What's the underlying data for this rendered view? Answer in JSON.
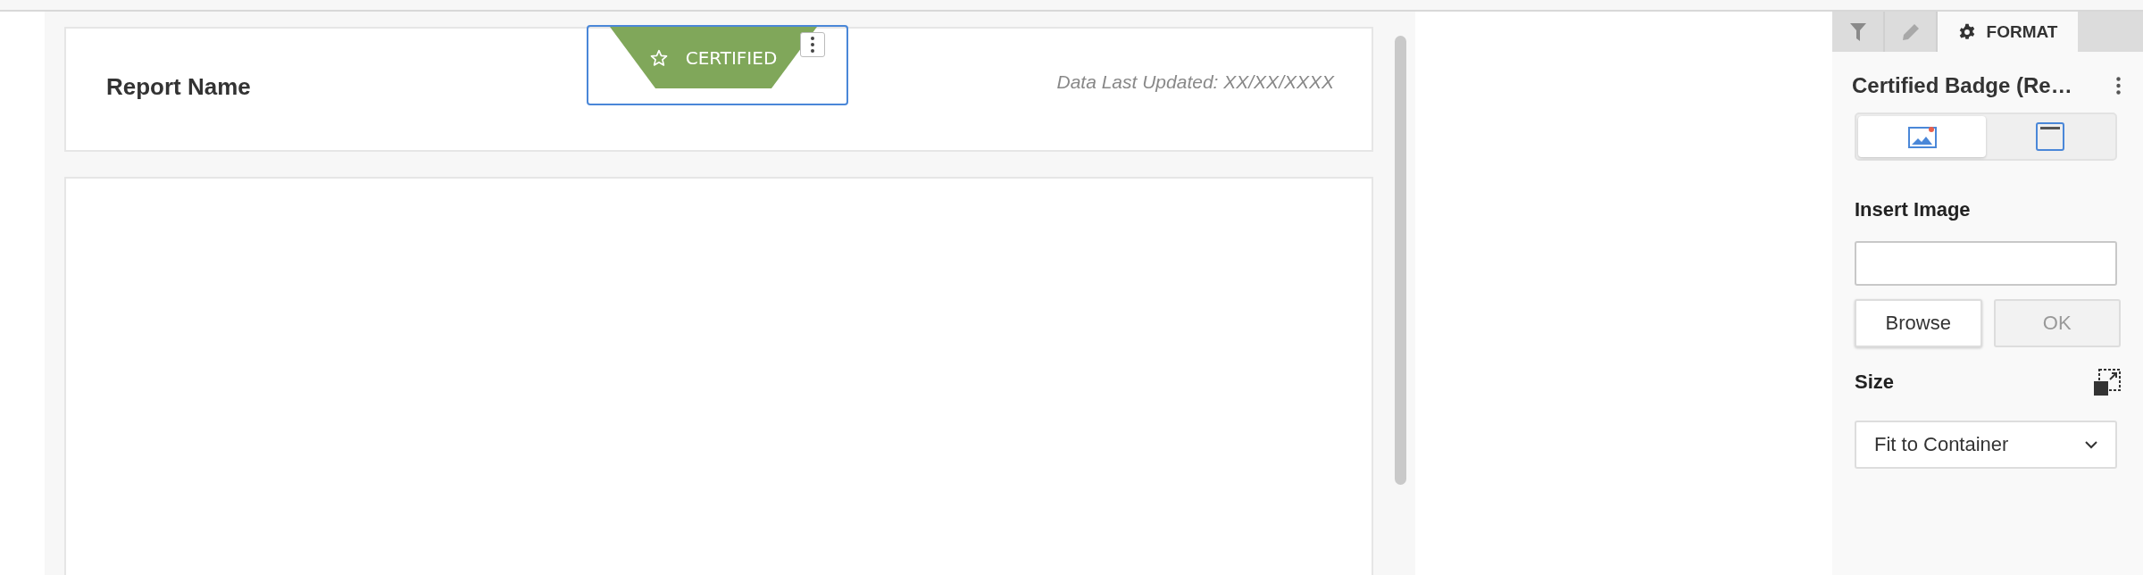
{
  "report": {
    "title": "Report Name",
    "updated": "Data Last Updated: XX/XX/XXXX",
    "badge": {
      "label": "CERTIFIED",
      "selected": true
    }
  },
  "panel": {
    "tabs": [
      {
        "kind": "filter",
        "selected": false
      },
      {
        "kind": "edit",
        "selected": false
      },
      {
        "kind": "format",
        "label": "FORMAT",
        "selected": true
      }
    ],
    "title": "Certified Badge (Re…",
    "modes": [
      {
        "kind": "image",
        "selected": true
      },
      {
        "kind": "banner",
        "selected": false
      }
    ],
    "insert_label": "Insert Image",
    "buttons": [
      {
        "label": "Browse",
        "disabled": false
      },
      {
        "label": "OK",
        "disabled": true
      }
    ],
    "size_label": "Size",
    "size_select": {
      "value": "Fit to Container"
    }
  }
}
